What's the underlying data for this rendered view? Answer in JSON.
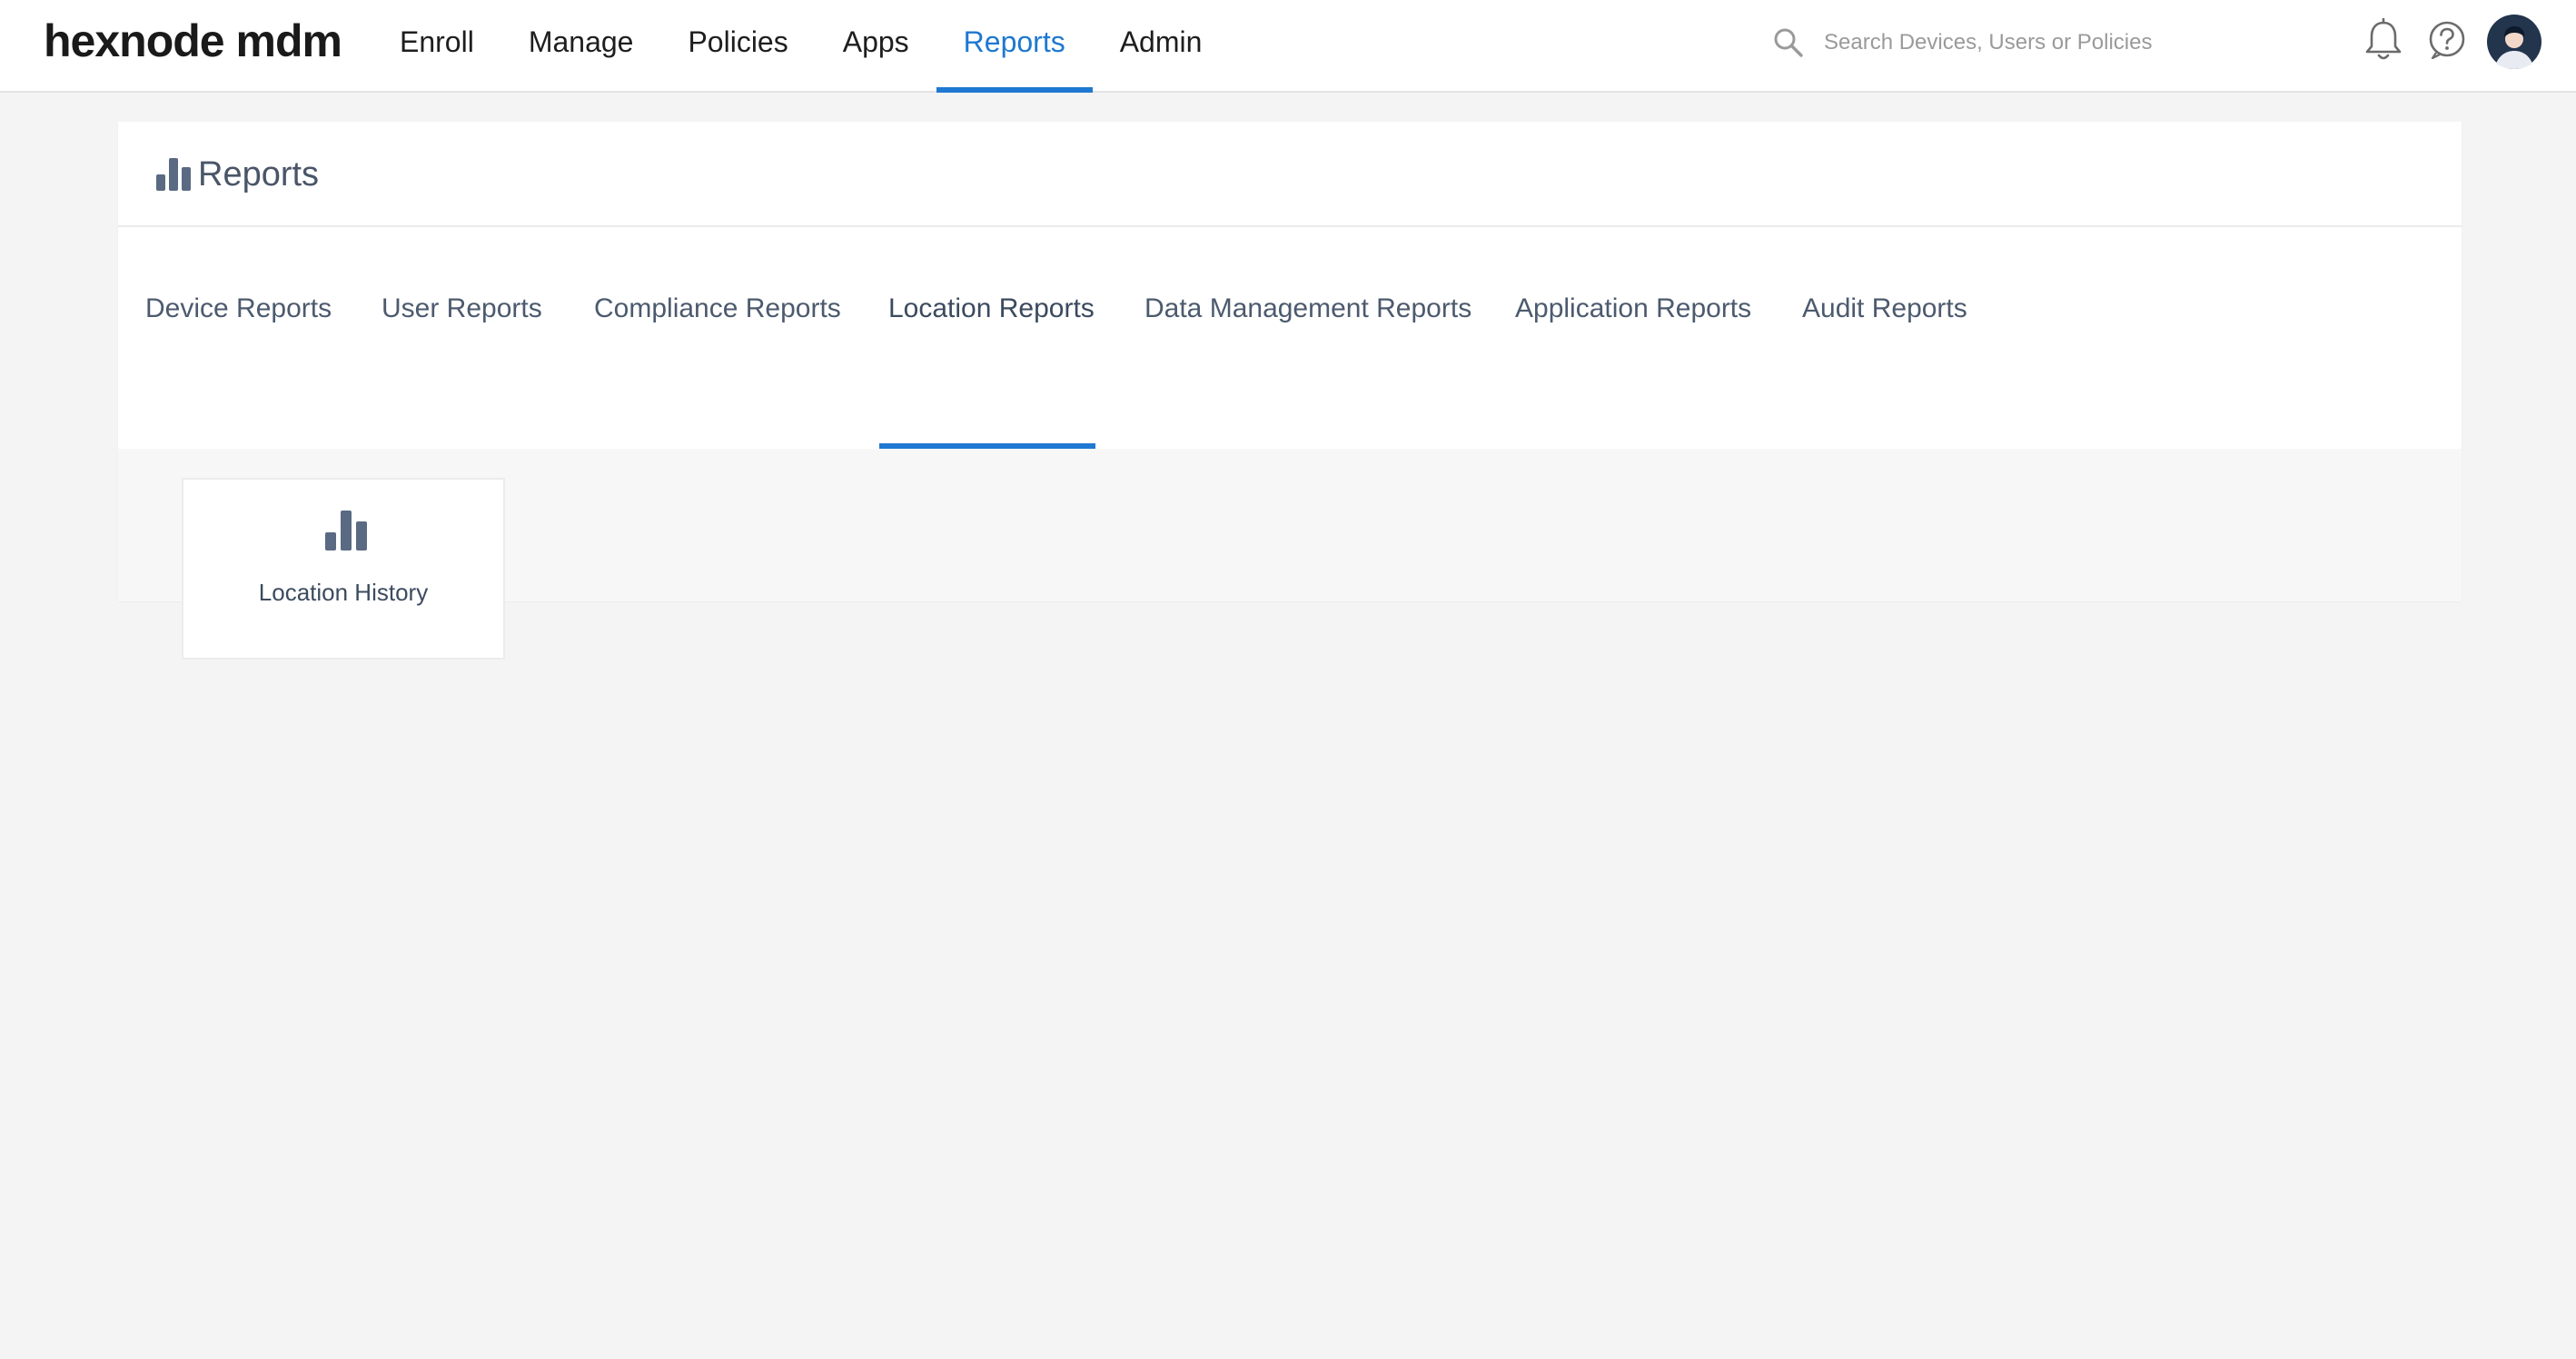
{
  "brand": {
    "logo": "hexnode mdm"
  },
  "nav": {
    "items": [
      {
        "label": "Enroll",
        "active": false
      },
      {
        "label": "Manage",
        "active": false
      },
      {
        "label": "Policies",
        "active": false
      },
      {
        "label": "Apps",
        "active": false
      },
      {
        "label": "Reports",
        "active": true
      },
      {
        "label": "Admin",
        "active": false
      }
    ]
  },
  "search": {
    "placeholder": "Search Devices, Users or Policies",
    "icon": "search-icon"
  },
  "header_icons": {
    "notifications": "bell-icon",
    "help": "help-icon",
    "avatar": "user-avatar"
  },
  "page": {
    "title": "Reports",
    "title_icon": "bar-chart-icon"
  },
  "tabs": [
    {
      "label": "Device Reports",
      "active": false
    },
    {
      "label": "User Reports",
      "active": false
    },
    {
      "label": "Compliance Reports",
      "active": false
    },
    {
      "label": "Location Reports",
      "active": true
    },
    {
      "label": "Data Management Reports",
      "active": false
    },
    {
      "label": "Application Reports",
      "active": false
    },
    {
      "label": "Audit Reports",
      "active": false
    }
  ],
  "reports": [
    {
      "label": "Location History",
      "icon": "bar-chart-icon"
    }
  ],
  "colors": {
    "accent": "#1f78d1",
    "page_background": "#f4f4f4",
    "icon_slate": "#5a6a82"
  }
}
